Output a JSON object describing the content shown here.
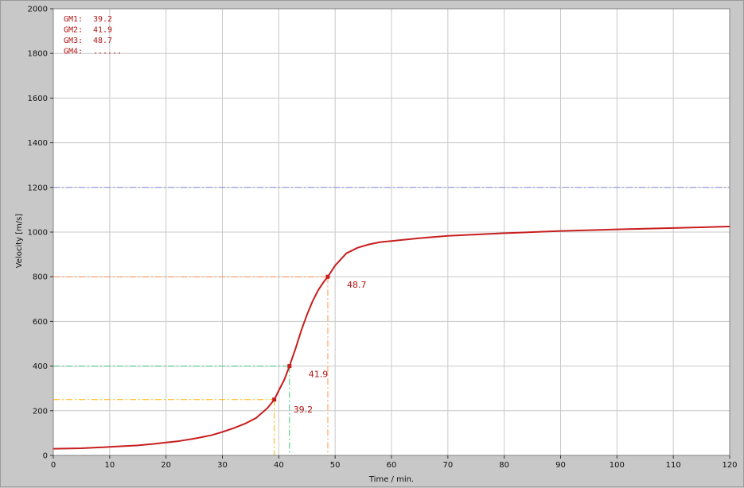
{
  "chart_data": {
    "type": "line",
    "xlabel": "Time / min.",
    "ylabel": "Velocity [m/s]",
    "xlim": [
      0,
      120
    ],
    "ylim": [
      0,
      2000
    ],
    "xticks": [
      0,
      10,
      20,
      30,
      40,
      50,
      60,
      70,
      80,
      90,
      100,
      110,
      120
    ],
    "yticks": [
      0,
      200,
      400,
      600,
      800,
      1000,
      1200,
      1400,
      1600,
      1800,
      2000
    ],
    "grid": true,
    "colors": {
      "plot_bg": "#ffffff",
      "frame_bg": "#c8c8c8",
      "grid": "#c8c8c8",
      "curve": "#c81e1e",
      "text_red": "#b41414",
      "gm1": "#ffb400",
      "gm2": "#3cc878",
      "gm3": "#ff9650",
      "threshold": "#8c8ce6"
    },
    "series": [
      {
        "x": [
          0,
          5,
          10,
          15,
          18,
          20,
          22,
          25,
          28,
          30,
          32,
          34,
          36,
          38,
          39.2,
          40,
          41,
          41.9,
          43,
          44,
          45,
          46,
          47,
          48,
          48.7,
          50,
          52,
          54,
          56,
          58,
          60,
          65,
          70,
          80,
          90,
          100,
          110,
          120
        ],
        "y": [
          30,
          32,
          38,
          45,
          52,
          58,
          63,
          75,
          90,
          105,
          122,
          142,
          168,
          212,
          250,
          290,
          340,
          400,
          480,
          560,
          630,
          690,
          740,
          778,
          800,
          850,
          905,
          930,
          945,
          955,
          960,
          973,
          983,
          995,
          1005,
          1012,
          1018,
          1025
        ]
      }
    ],
    "threshold_line": {
      "y": 1200
    },
    "markers": [
      {
        "id": "GM1",
        "x": 39.2,
        "y": 250,
        "label": "39.2"
      },
      {
        "id": "GM2",
        "x": 41.9,
        "y": 400,
        "label": "41.9"
      },
      {
        "id": "GM3",
        "x": 48.7,
        "y": 800,
        "label": "48.7"
      }
    ],
    "legend": [
      {
        "name": "GM1:",
        "value": "39.2"
      },
      {
        "name": "GM2:",
        "value": "41.9"
      },
      {
        "name": "GM3:",
        "value": "48.7"
      },
      {
        "name": "GM4:",
        "value": "......"
      }
    ]
  }
}
